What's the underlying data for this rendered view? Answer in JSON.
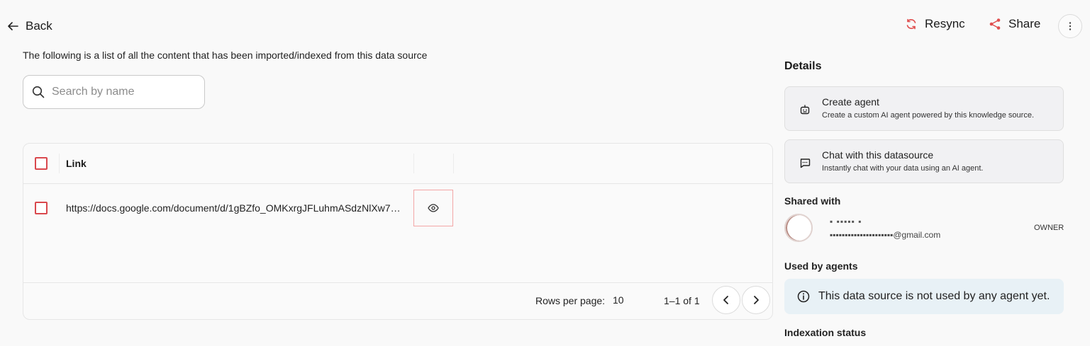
{
  "header": {
    "back_label": "Back",
    "resync_label": "Resync",
    "share_label": "Share"
  },
  "intro_text": "The following is a list of all the content that has been imported/indexed from this data source",
  "search": {
    "placeholder": "Search by name",
    "value": ""
  },
  "table": {
    "columns": [
      "Link"
    ],
    "rows": [
      {
        "link": "https://docs.google.com/document/d/1gBZfo_OMKxrgJFLuhmASdzNlXw7C..."
      }
    ],
    "footer": {
      "rows_per_page_label": "Rows per page:",
      "rows_per_page_value": "10",
      "range_text": "1–1 of 1"
    }
  },
  "details": {
    "title": "Details",
    "cards": [
      {
        "title": "Create agent",
        "description": "Create a custom AI agent powered by this knowledge source.",
        "icon": "robot-icon"
      },
      {
        "title": "Chat with this datasource",
        "description": "Instantly chat with your data using an AI agent.",
        "icon": "chat-icon"
      }
    ],
    "shared_with_title": "Shared with",
    "shared_users": [
      {
        "name": "▪ ▪▪▪▪▪ ▪",
        "email": "▪▪▪▪▪▪▪▪▪▪▪▪▪▪▪▪▪▪▪▪▪@gmail.com",
        "role": "OWNER"
      }
    ],
    "used_by_agents_title": "Used by agents",
    "used_by_agents_message": "This data source is not used by any agent yet.",
    "indexation_status_title": "Indexation status"
  },
  "colors": {
    "accent": "#d9484d",
    "info_bg": "#e8f1f6"
  }
}
